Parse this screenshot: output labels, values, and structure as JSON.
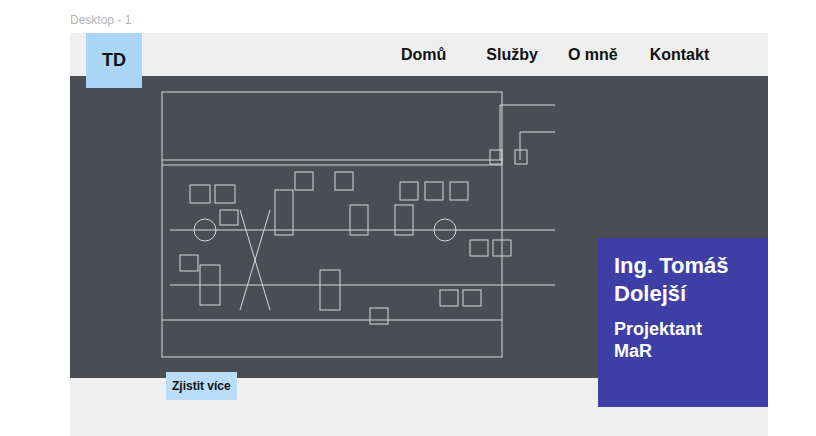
{
  "canvas": {
    "label": "Desktop - 1"
  },
  "logo": "TD",
  "nav": [
    {
      "label": "Domů"
    },
    {
      "label": "Služby"
    },
    {
      "label": "O mně"
    },
    {
      "label": "Kontakt"
    }
  ],
  "hero": {
    "title": "Ing. Tomáš Dolejší",
    "subtitle": "Projektant MaR",
    "button": "Zjistit více"
  }
}
